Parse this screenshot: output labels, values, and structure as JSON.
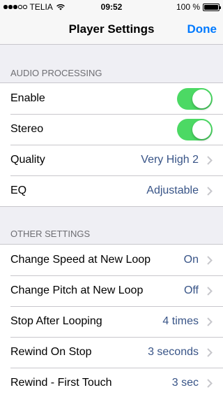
{
  "status_bar": {
    "carrier": "TELIA",
    "time": "09:52",
    "battery": "100 %"
  },
  "nav": {
    "title": "Player Settings",
    "done_label": "Done"
  },
  "accent_color": "#007aff",
  "toggle_on_color": "#4cd964",
  "value_color": "#385487",
  "audio_processing": {
    "header": "AUDIO PROCESSING",
    "rows": [
      {
        "label": "Enable",
        "toggle_on": true
      },
      {
        "label": "Stereo",
        "toggle_on": true
      },
      {
        "label": "Quality",
        "value": "Very High 2"
      },
      {
        "label": "EQ",
        "value": "Adjustable"
      }
    ]
  },
  "other_settings": {
    "header": "OTHER SETTINGS",
    "rows": [
      {
        "label": "Change Speed at New Loop",
        "value": "On"
      },
      {
        "label": "Change Pitch at New Loop",
        "value": "Off"
      },
      {
        "label": "Stop After Looping",
        "value": "4 times"
      },
      {
        "label": "Rewind On Stop",
        "value": "3 seconds"
      },
      {
        "label": "Rewind - First Touch",
        "value": "3 sec"
      }
    ]
  }
}
